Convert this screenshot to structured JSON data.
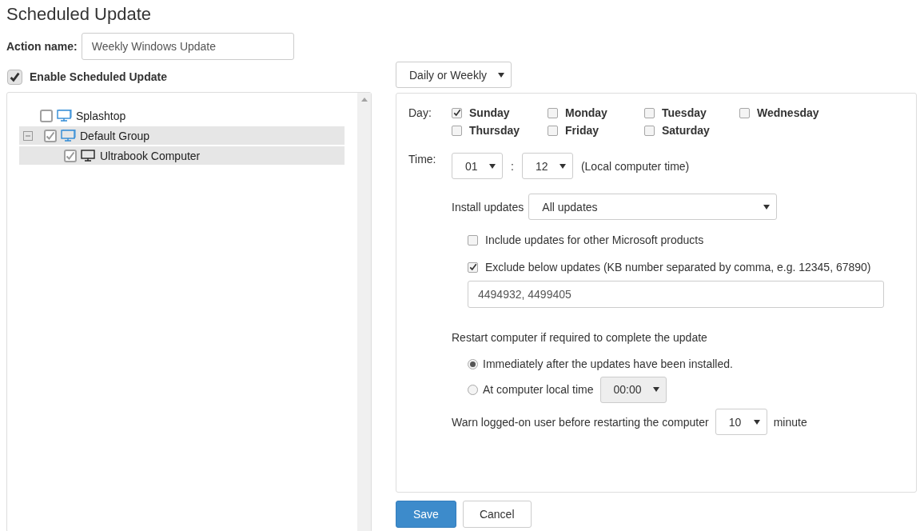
{
  "title": "Scheduled Update",
  "action_name": {
    "label": "Action name:",
    "value": "Weekly Windows Update"
  },
  "enable": {
    "label": "Enable Scheduled Update",
    "checked": true
  },
  "tree": [
    {
      "label": "Splashtop",
      "kind": "group",
      "checked": false,
      "selected": false
    },
    {
      "label": "Default Group",
      "kind": "group",
      "checked": true,
      "selected": true,
      "expanded": true,
      "children": [
        {
          "label": "Ultrabook Computer",
          "kind": "computer",
          "checked": true,
          "selected": true
        }
      ]
    }
  ],
  "schedule_type": {
    "value": "Daily or Weekly"
  },
  "day": {
    "label": "Day:",
    "days": [
      {
        "label": "Sunday",
        "checked": true
      },
      {
        "label": "Monday",
        "checked": false
      },
      {
        "label": "Tuesday",
        "checked": false
      },
      {
        "label": "Wednesday",
        "checked": false
      },
      {
        "label": "Thursday",
        "checked": false
      },
      {
        "label": "Friday",
        "checked": false
      },
      {
        "label": "Saturday",
        "checked": false
      }
    ]
  },
  "time": {
    "label": "Time:",
    "hour": "01",
    "separator": ":",
    "minute": "12",
    "note": "(Local computer time)"
  },
  "install": {
    "label": "Install updates",
    "value": "All updates"
  },
  "options": [
    {
      "label": "Include updates for other Microsoft products",
      "checked": false
    },
    {
      "label": "Exclude below updates (KB number separated by comma, e.g. 12345, 67890)",
      "checked": true
    }
  ],
  "excluded_kbs": {
    "value": "4494932, 4499405"
  },
  "restart": {
    "label": "Restart computer if required to complete the update",
    "choices": [
      {
        "label": "Immediately after the updates have been installed.",
        "selected": true
      },
      {
        "label": "At computer local time",
        "selected": false,
        "time": {
          "value": "00:00",
          "disabled": true
        }
      }
    ]
  },
  "warn": {
    "label": "Warn logged-on user before restarting the computer",
    "value": "10",
    "unit": "minute"
  },
  "buttons": [
    {
      "label": "Save",
      "kind": "primary"
    },
    {
      "label": "Cancel",
      "kind": "default"
    }
  ]
}
